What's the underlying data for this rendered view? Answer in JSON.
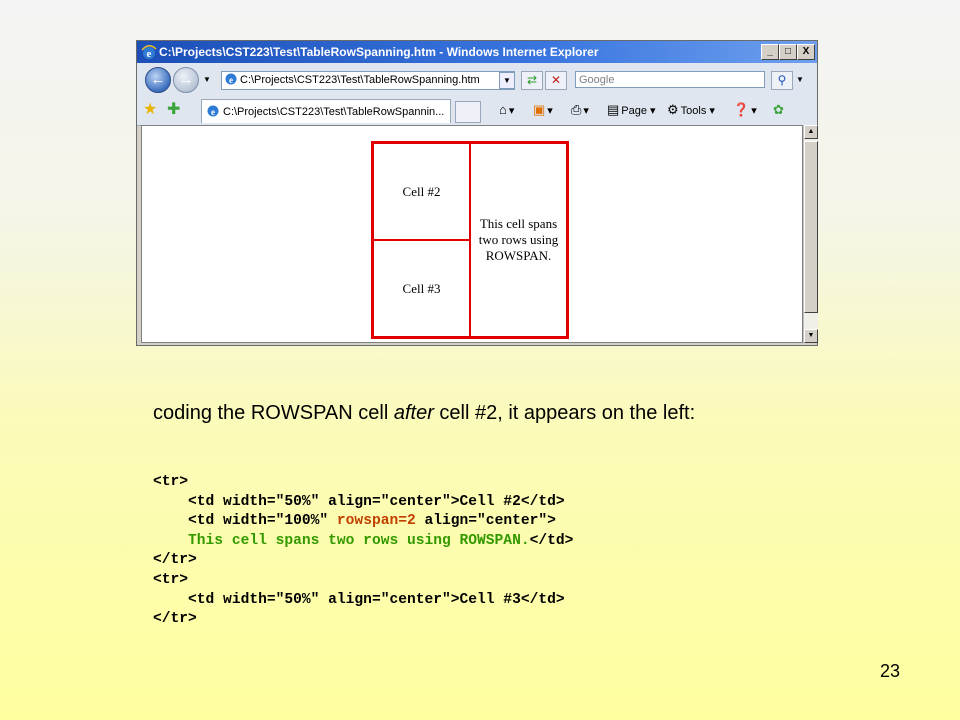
{
  "window": {
    "title": "C:\\Projects\\CST223\\Test\\TableRowSpanning.htm - Windows Internet Explorer",
    "address": "C:\\Projects\\CST223\\Test\\TableRowSpanning.htm",
    "search_placeholder": "Google",
    "tab_label": "C:\\Projects\\CST223\\Test\\TableRowSpannin...",
    "toolbar": {
      "page_label": "Page",
      "tools_label": "Tools"
    },
    "buttons": {
      "minimize": "_",
      "maximize": "□",
      "close": "X"
    }
  },
  "rendered_table": {
    "cell2": "Cell #2",
    "cell3": "Cell #3",
    "span_cell": "This cell spans two rows using ROWSPAN."
  },
  "slide": {
    "caption_part1": "coding the ROWSPAN cell ",
    "caption_em": "after",
    "caption_part2": " cell #2, it appears on the left:",
    "code": {
      "line1": "<tr>",
      "line2": "    <td width=\"50%\" align=\"center\">Cell #2</td>",
      "line3a": "    <td width=\"100%\" ",
      "line3b": "rowspan=2",
      "line3c": " align=\"center\">",
      "line4a": "    This cell spans two rows using ROWSPAN.",
      "line4b": "</td>",
      "line5": "</tr>",
      "line6": "<tr>",
      "line7": "    <td width=\"50%\" align=\"center\">Cell #3</td>",
      "line8": "</tr>"
    },
    "page_number": "23"
  },
  "colors": {
    "table_border": "#e00000",
    "code_attr": "#c04000",
    "code_green": "#339900"
  },
  "icons": [
    "ie-icon",
    "back-icon",
    "forward-icon",
    "refresh-icon",
    "stop-icon",
    "search-icon",
    "favorites-star-icon",
    "add-favorite-icon",
    "home-icon",
    "feeds-icon",
    "print-icon",
    "page-icon",
    "tools-icon",
    "help-icon",
    "research-icon"
  ]
}
